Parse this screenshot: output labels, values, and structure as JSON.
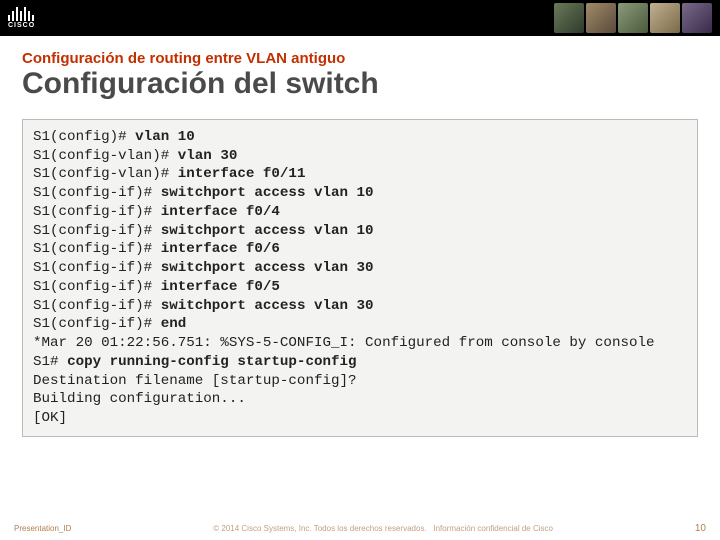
{
  "logo_text": "CISCO",
  "subtitle": "Configuración de routing entre VLAN antiguo",
  "title": "Configuración del switch",
  "terminal": [
    {
      "p": "S1(config)# ",
      "c": "vlan 10"
    },
    {
      "p": "S1(config-vlan)# ",
      "c": "vlan 30"
    },
    {
      "p": "S1(config-vlan)# ",
      "c": "interface f0/11"
    },
    {
      "p": "S1(config-if)# ",
      "c": "switchport access vlan 10"
    },
    {
      "p": "S1(config-if)# ",
      "c": "interface f0/4"
    },
    {
      "p": "S1(config-if)# ",
      "c": "switchport access vlan 10"
    },
    {
      "p": "S1(config-if)# ",
      "c": "interface f0/6"
    },
    {
      "p": "S1(config-if)# ",
      "c": "switchport access vlan 30"
    },
    {
      "p": "S1(config-if)# ",
      "c": "interface f0/5"
    },
    {
      "p": "S1(config-if)# ",
      "c": "switchport access vlan 30"
    },
    {
      "p": "S1(config-if)# ",
      "c": "end"
    },
    {
      "t": "*Mar 20 01:22:56.751: %SYS-5-CONFIG_I: Configured from console by console"
    },
    {
      "p": "S1# ",
      "c": "copy running-config startup-config"
    },
    {
      "t": "Destination filename [startup-config]?"
    },
    {
      "t": "Building configuration..."
    },
    {
      "t": "[OK]"
    }
  ],
  "footer": {
    "left": "Presentation_ID",
    "mid": "© 2014 Cisco Systems, Inc. Todos los derechos reservados.",
    "right": "Información confidencial de Cisco",
    "page": "10"
  }
}
